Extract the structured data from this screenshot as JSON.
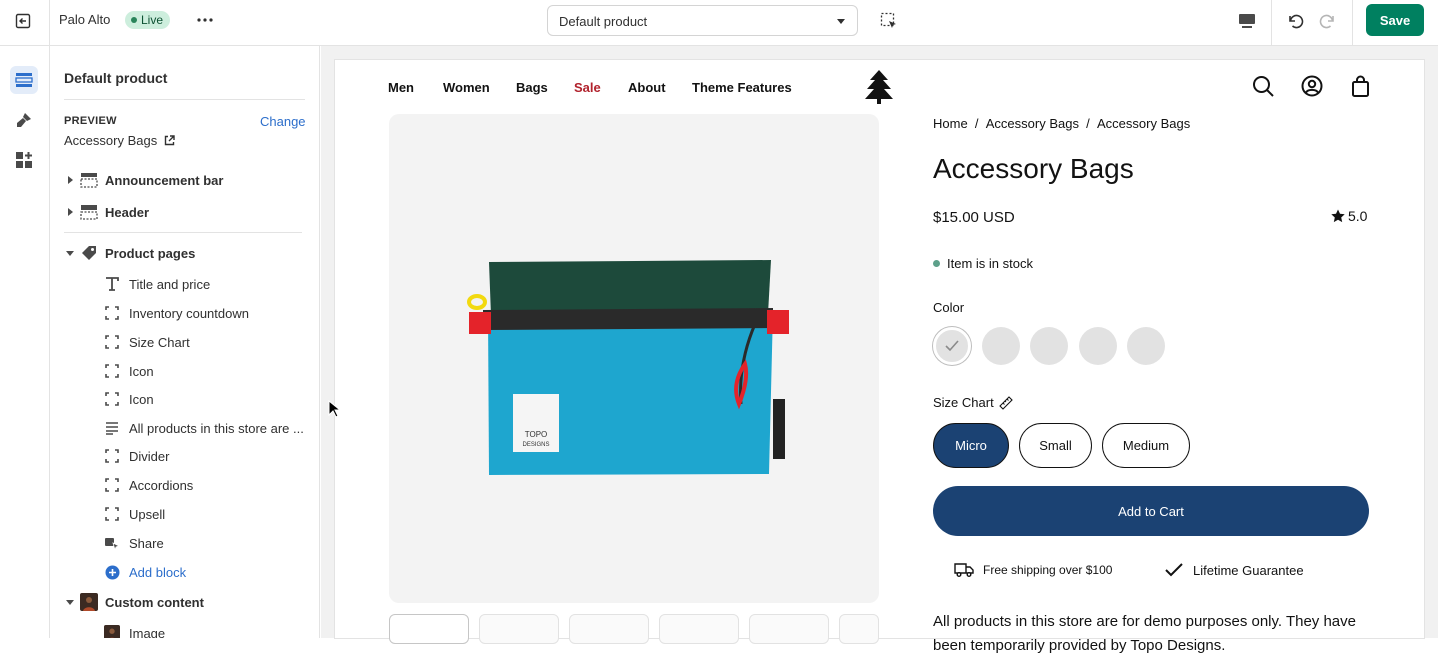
{
  "topbar": {
    "store_name": "Palo Alto",
    "status_badge": "Live",
    "template_select": "Default product",
    "save_label": "Save"
  },
  "sidebar": {
    "title": "Default product",
    "preview_label": "PREVIEW",
    "change_label": "Change",
    "preview_value": "Accessory Bags",
    "sections": [
      {
        "label": "Announcement bar",
        "icon": "section-icon"
      },
      {
        "label": "Header",
        "icon": "section-icon"
      },
      {
        "label": "Product pages",
        "icon": "tag-icon"
      },
      {
        "label": "Custom content",
        "icon": "image-thumb-icon"
      }
    ],
    "blocks": [
      {
        "label": "Title and price",
        "icon": "text-icon"
      },
      {
        "label": "Inventory countdown",
        "icon": "block-icon"
      },
      {
        "label": "Size Chart",
        "icon": "block-icon"
      },
      {
        "label": "Icon",
        "icon": "block-icon"
      },
      {
        "label": "Icon",
        "icon": "block-icon"
      },
      {
        "label": "All products in this store are ...",
        "icon": "paragraph-icon"
      },
      {
        "label": "Divider",
        "icon": "block-icon"
      },
      {
        "label": "Accordions",
        "icon": "block-icon"
      },
      {
        "label": "Upsell",
        "icon": "block-icon"
      },
      {
        "label": "Share",
        "icon": "share-icon"
      }
    ],
    "add_block": "Add block",
    "custom_blocks": [
      {
        "label": "Image",
        "icon": "image-thumb-icon"
      }
    ]
  },
  "storefront": {
    "nav": [
      "Men",
      "Women",
      "Bags",
      "Sale",
      "About",
      "Theme Features"
    ],
    "accent_sale_color": "#b1222d",
    "breadcrumb": [
      "Home",
      "Accessory Bags",
      "Accessory Bags"
    ],
    "product_title": "Accessory Bags",
    "price": "$15.00 USD",
    "rating": "5.0",
    "stock": "Item is in stock",
    "color_label": "Color",
    "size_label": "Size Chart",
    "sizes": [
      "Micro",
      "Small",
      "Medium"
    ],
    "selected_size": "Micro",
    "add_to_cart": "Add to Cart",
    "perks": [
      "Free shipping over $100",
      "Lifetime Guarantee"
    ],
    "description": "All products in this store are for demo purposes only. They have been temporarily provided by Topo Designs.",
    "primary_color": "#1b4273",
    "bag_label_line1": "TOPO",
    "bag_label_line2": "DESIGNS"
  }
}
